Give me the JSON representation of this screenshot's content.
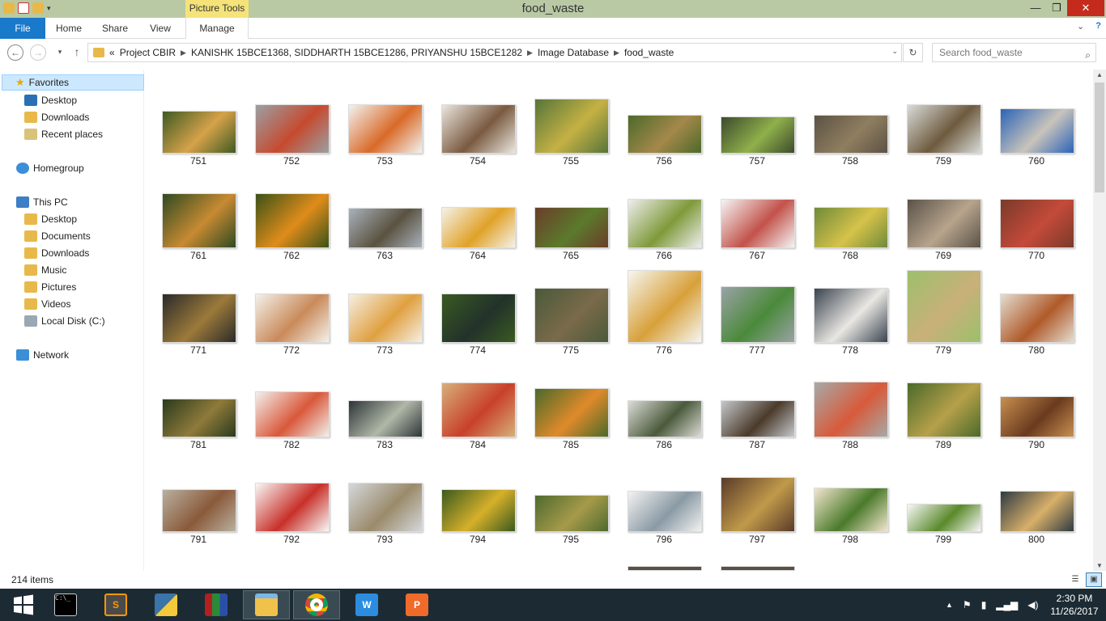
{
  "window": {
    "title": "food_waste",
    "context_tab": "Picture Tools",
    "min": "—",
    "max": "❐",
    "close": "✕"
  },
  "ribbon": {
    "tabs": [
      "File",
      "Home",
      "Share",
      "View",
      "Manage"
    ],
    "expand": "⌄",
    "help": "?"
  },
  "nav": {
    "back": "←",
    "forward": "→",
    "recent": "▾",
    "up": "↑"
  },
  "address": {
    "prefix": "«",
    "crumbs": [
      "Project CBIR",
      "KANISHK 15BCE1368, SIDDHARTH 15BCE1286, PRIYANSHU 15BCE1282",
      "Image Database",
      "food_waste"
    ],
    "sep": "▶",
    "dropdown": "⌄"
  },
  "refresh": "↻",
  "search": {
    "placeholder": "Search food_waste",
    "icon": "search-icon"
  },
  "navpane": {
    "favorites": "Favorites",
    "fav_items": [
      "Desktop",
      "Downloads",
      "Recent places"
    ],
    "homegroup": "Homegroup",
    "thispc": "This PC",
    "pc_items": [
      "Desktop",
      "Documents",
      "Downloads",
      "Music",
      "Pictures",
      "Videos",
      "Local Disk (C:)"
    ],
    "network": "Network"
  },
  "files": [
    {
      "name": "751",
      "colors": [
        "#3e5a22",
        "#d6a24a"
      ],
      "ar": 0.58
    },
    {
      "name": "752",
      "colors": [
        "#9aa0a4",
        "#c64a2f"
      ],
      "ar": 0.66
    },
    {
      "name": "753",
      "colors": [
        "#f2f2ef",
        "#d96a28"
      ],
      "ar": 0.66
    },
    {
      "name": "754",
      "colors": [
        "#eae6df",
        "#7a5a40"
      ],
      "ar": 0.66
    },
    {
      "name": "755",
      "colors": [
        "#56753a",
        "#c5b144"
      ],
      "ar": 0.74
    },
    {
      "name": "756",
      "colors": [
        "#4c6a2a",
        "#a4884a"
      ],
      "ar": 0.52
    },
    {
      "name": "757",
      "colors": [
        "#3d4a2e",
        "#8fb04a"
      ],
      "ar": 0.5
    },
    {
      "name": "758",
      "colors": [
        "#5c5244",
        "#8f7e60"
      ],
      "ar": 0.52
    },
    {
      "name": "759",
      "colors": [
        "#d8dcd8",
        "#6e5a3e"
      ],
      "ar": 0.66
    },
    {
      "name": "760",
      "colors": [
        "#2a63b8",
        "#c9c4bb"
      ],
      "ar": 0.61
    },
    {
      "name": "761",
      "colors": [
        "#2f4a22",
        "#c78a32"
      ],
      "ar": 0.74
    },
    {
      "name": "762",
      "colors": [
        "#3b5218",
        "#e08c1a"
      ],
      "ar": 0.74
    },
    {
      "name": "763",
      "colors": [
        "#a9b2bb",
        "#5a5240"
      ],
      "ar": 0.54
    },
    {
      "name": "764",
      "colors": [
        "#f4f2ea",
        "#e0a228"
      ],
      "ar": 0.55
    },
    {
      "name": "765",
      "colors": [
        "#6a3d2a",
        "#5b7a2c"
      ],
      "ar": 0.55
    },
    {
      "name": "766",
      "colors": [
        "#eeeeee",
        "#7f9a3a"
      ],
      "ar": 0.66
    },
    {
      "name": "767",
      "colors": [
        "#f5f5f5",
        "#c2524a"
      ],
      "ar": 0.66
    },
    {
      "name": "768",
      "colors": [
        "#6f8a3a",
        "#d6c24a"
      ],
      "ar": 0.55
    },
    {
      "name": "769",
      "colors": [
        "#5a5248",
        "#b7a48c"
      ],
      "ar": 0.66
    },
    {
      "name": "770",
      "colors": [
        "#7a3a2a",
        "#c44a3a"
      ],
      "ar": 0.66
    },
    {
      "name": "771",
      "colors": [
        "#2a2a2a",
        "#9c7a3a"
      ],
      "ar": 0.66
    },
    {
      "name": "772",
      "colors": [
        "#f4f1ea",
        "#c98a5a"
      ],
      "ar": 0.66
    },
    {
      "name": "773",
      "colors": [
        "#f5efe3",
        "#e0a040"
      ],
      "ar": 0.66
    },
    {
      "name": "774",
      "colors": [
        "#3a5a22",
        "#22322a"
      ],
      "ar": 0.66
    },
    {
      "name": "775",
      "colors": [
        "#4a5a3a",
        "#7a6a4a"
      ],
      "ar": 0.74
    },
    {
      "name": "776",
      "colors": [
        "#f6f6f0",
        "#d8a03a"
      ],
      "ar": 0.98
    },
    {
      "name": "777",
      "colors": [
        "#9aa2a6",
        "#4a8a3a"
      ],
      "ar": 0.76
    },
    {
      "name": "778",
      "colors": [
        "#3a4450",
        "#e9e7e2"
      ],
      "ar": 0.74
    },
    {
      "name": "779",
      "colors": [
        "#9cc06a",
        "#c9b07a"
      ],
      "ar": 0.98
    },
    {
      "name": "780",
      "colors": [
        "#e3ddd0",
        "#b05a2a"
      ],
      "ar": 0.66
    },
    {
      "name": "781",
      "colors": [
        "#2a3a1e",
        "#8f7a3a"
      ],
      "ar": 0.52
    },
    {
      "name": "782",
      "colors": [
        "#f2f0ec",
        "#d9583a"
      ],
      "ar": 0.62
    },
    {
      "name": "783",
      "colors": [
        "#2e3438",
        "#b0b8a8"
      ],
      "ar": 0.5
    },
    {
      "name": "784",
      "colors": [
        "#d6b07a",
        "#c8402a"
      ],
      "ar": 0.74
    },
    {
      "name": "785",
      "colors": [
        "#4a6a2a",
        "#e08a2a"
      ],
      "ar": 0.66
    },
    {
      "name": "786",
      "colors": [
        "#dcdcd8",
        "#4a5a3a"
      ],
      "ar": 0.5
    },
    {
      "name": "787",
      "colors": [
        "#c4c8cc",
        "#4a3a2a"
      ],
      "ar": 0.5
    },
    {
      "name": "788",
      "colors": [
        "#a6aaa8",
        "#d85a3a"
      ],
      "ar": 0.75
    },
    {
      "name": "789",
      "colors": [
        "#4a6a2a",
        "#b6a04a"
      ],
      "ar": 0.74
    },
    {
      "name": "790",
      "colors": [
        "#c89050",
        "#6a3a1e"
      ],
      "ar": 0.55
    },
    {
      "name": "791",
      "colors": [
        "#b9b0a0",
        "#8a5a3a"
      ],
      "ar": 0.58
    },
    {
      "name": "792",
      "colors": [
        "#f8f8f6",
        "#c8302a"
      ],
      "ar": 0.66
    },
    {
      "name": "793",
      "colors": [
        "#d4d8dc",
        "#9a8a6a"
      ],
      "ar": 0.66
    },
    {
      "name": "794",
      "colors": [
        "#3a5a1e",
        "#d6b02a"
      ],
      "ar": 0.58
    },
    {
      "name": "795",
      "colors": [
        "#4e6a2e",
        "#a69a4a"
      ],
      "ar": 0.5
    },
    {
      "name": "796",
      "colors": [
        "#f2f2f2",
        "#8a9aa4"
      ],
      "ar": 0.55
    },
    {
      "name": "797",
      "colors": [
        "#5a3a2a",
        "#c09a4a"
      ],
      "ar": 0.74
    },
    {
      "name": "798",
      "colors": [
        "#f3e6cf",
        "#4a7a2a"
      ],
      "ar": 0.6
    },
    {
      "name": "799",
      "colors": [
        "#f8f8f8",
        "#5a8a2a"
      ],
      "ar": 0.38
    },
    {
      "name": "800",
      "colors": [
        "#2e3a42",
        "#d8b06a"
      ],
      "ar": 0.55
    }
  ],
  "status": {
    "count": "214 items"
  },
  "taskbar": {
    "apps": [
      "start-icon",
      "cmd-icon",
      "sublime-text-icon",
      "python-icon",
      "winrar-icon",
      "file-explorer-icon",
      "chrome-icon",
      "wps-writer-icon",
      "wps-presentation-icon"
    ]
  },
  "tray": {
    "expand": "▲",
    "time": "2:30 PM",
    "date": "11/26/2017"
  },
  "colors": {
    "titlebar": "#b9c9a4",
    "file_tab": "#1979ca",
    "selection": "#cce8ff",
    "taskbar": "#1c2b33",
    "close": "#c42b1c"
  }
}
